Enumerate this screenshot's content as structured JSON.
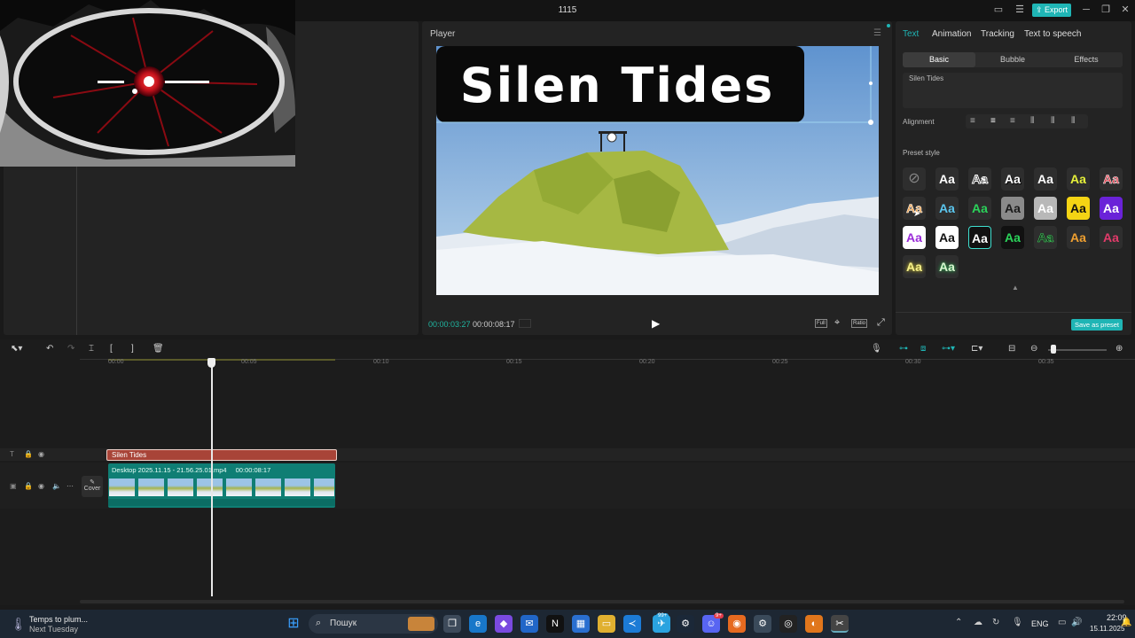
{
  "window": {
    "title": "1115",
    "export_label": "Export"
  },
  "player": {
    "title": "Player",
    "current_time": "00:00:03:27",
    "total_time": "00:00:08:17",
    "overlay_text": "Silen Tides",
    "buttons": {
      "full": "Full",
      "ratio": "Ratio"
    }
  },
  "right_panel": {
    "tabs": [
      "Text",
      "Animation",
      "Tracking",
      "Text to speech"
    ],
    "active_tab": "Text",
    "subtabs": [
      "Basic",
      "Bubble",
      "Effects"
    ],
    "active_subtab": "Basic",
    "text_value": "Silen Tides",
    "alignment_label": "Alignment",
    "preset_style_label": "Preset style",
    "preset_glyph": "Aa",
    "save_preset_label": "Save as preset"
  },
  "timeline": {
    "ticks": [
      "00:00",
      "00:05",
      "00:10",
      "00:15",
      "00:20",
      "00:25",
      "00:30",
      "00:35"
    ],
    "text_clip_label": "Silen Tides",
    "video_clip_label": "Desktop 2025.11.15 - 21.56.25.01.mp4",
    "video_clip_duration": "00:00:08:17",
    "cover_label": "Cover"
  },
  "taskbar": {
    "notif_title": "Temps to plum...",
    "notif_sub": "Next Tuesday",
    "search_placeholder": "Пошук",
    "lang": "ENG",
    "time": "22:09",
    "date": "15.11.2025",
    "badge_1": "99+",
    "badge_2": "9+"
  },
  "colors": {
    "accent": "#1fb5b5",
    "text_clip": "#a84438",
    "video_clip": "#0f7e74",
    "timecode": "#1fb5a0"
  }
}
